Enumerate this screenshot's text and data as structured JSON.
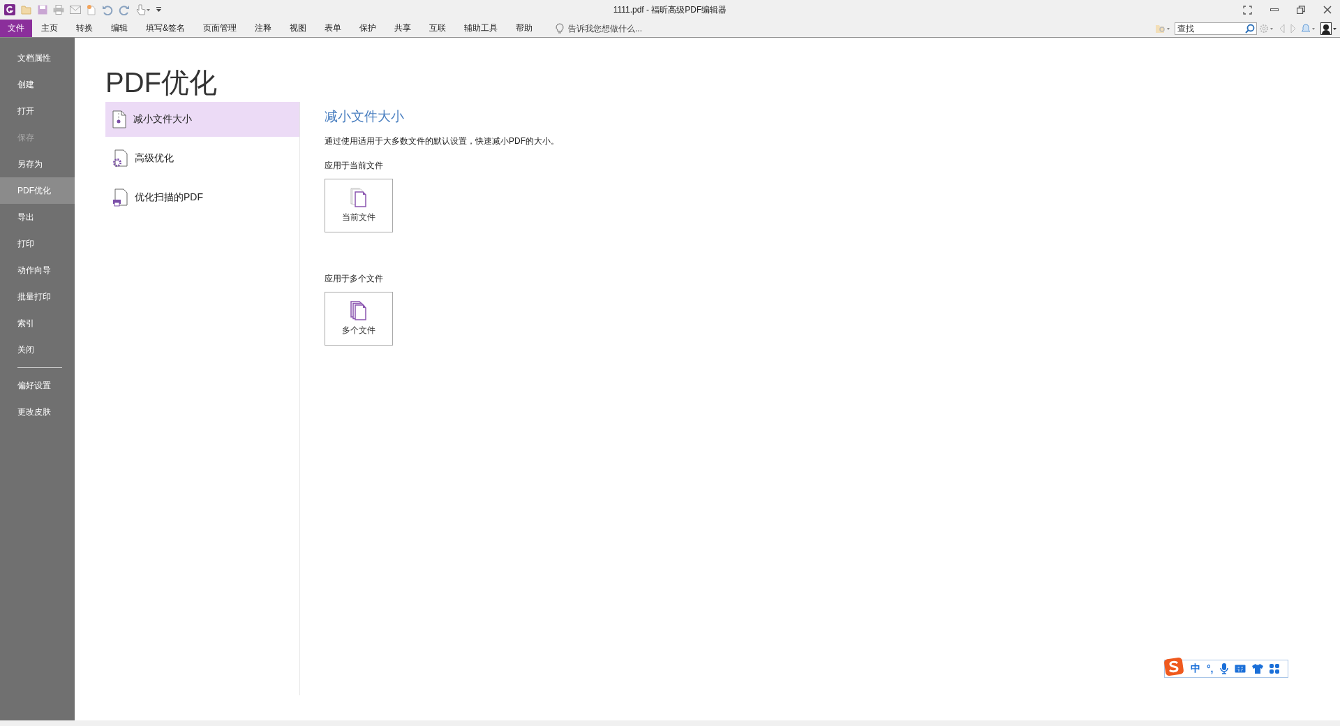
{
  "window": {
    "title": "1111.pdf - 福昕高级PDF编辑器"
  },
  "menu_tabs": [
    {
      "label": "文件",
      "selected": true
    },
    {
      "label": "主页",
      "selected": false
    },
    {
      "label": "转换",
      "selected": false
    },
    {
      "label": "编辑",
      "selected": false
    },
    {
      "label": "填写&签名",
      "selected": false
    },
    {
      "label": "页面管理",
      "selected": false
    },
    {
      "label": "注释",
      "selected": false
    },
    {
      "label": "视图",
      "selected": false
    },
    {
      "label": "表单",
      "selected": false
    },
    {
      "label": "保护",
      "selected": false
    },
    {
      "label": "共享",
      "selected": false
    },
    {
      "label": "互联",
      "selected": false
    },
    {
      "label": "辅助工具",
      "selected": false
    },
    {
      "label": "帮助",
      "selected": false
    }
  ],
  "tell_me": {
    "placeholder": "告诉我您想做什么..."
  },
  "search": {
    "placeholder": "查找"
  },
  "sidebar": {
    "items": [
      {
        "label": "文档属性",
        "selected": false,
        "disabled": false
      },
      {
        "label": "创建",
        "selected": false,
        "disabled": false
      },
      {
        "label": "打开",
        "selected": false,
        "disabled": false
      },
      {
        "label": "保存",
        "selected": false,
        "disabled": true
      },
      {
        "label": "另存为",
        "selected": false,
        "disabled": false
      },
      {
        "label": "PDF优化",
        "selected": true,
        "disabled": false
      },
      {
        "label": "导出",
        "selected": false,
        "disabled": false
      },
      {
        "label": "打印",
        "selected": false,
        "disabled": false
      },
      {
        "label": "动作向导",
        "selected": false,
        "disabled": false
      },
      {
        "label": "批量打印",
        "selected": false,
        "disabled": false
      },
      {
        "label": "索引",
        "selected": false,
        "disabled": false
      },
      {
        "label": "关闭",
        "selected": false,
        "disabled": false
      }
    ],
    "footer_items": [
      {
        "label": "偏好设置",
        "selected": false,
        "disabled": false
      },
      {
        "label": "更改皮肤",
        "selected": false,
        "disabled": false
      }
    ]
  },
  "page_title": "PDF优化",
  "options": [
    {
      "label": "减小文件大小",
      "kind": "compress",
      "selected": true
    },
    {
      "label": "高级优化",
      "kind": "advanced",
      "selected": false
    },
    {
      "label": "优化扫描的PDF",
      "kind": "scan",
      "selected": false
    }
  ],
  "detail": {
    "heading": "减小文件大小",
    "description": "通过使用适用于大多数文件的默认设置，快速减小PDF的大小。",
    "sections": [
      {
        "label": "应用于当前文件",
        "button": "当前文件",
        "kind": "single"
      },
      {
        "label": "应用于多个文件",
        "button": "多个文件",
        "kind": "multiple"
      }
    ]
  },
  "ime": {
    "mode": "中",
    "punctuation": "°,"
  }
}
